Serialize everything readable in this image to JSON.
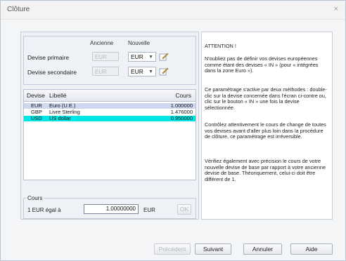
{
  "window": {
    "title": "Clôture",
    "close": "×"
  },
  "currency_config": {
    "header_old": "Ancienne",
    "header_new": "Nouvelle",
    "primary_label": "Devise primaire",
    "secondary_label": "Devise secondaire",
    "primary_old": "EUR",
    "primary_new": "EUR",
    "secondary_old": "EUR",
    "secondary_new": "EUR"
  },
  "table": {
    "headers": {
      "devise": "Devise",
      "libelle": "Libellé",
      "cours": "Cours"
    },
    "rows": [
      {
        "devise": "EUR",
        "libelle": "Euro (U.E.)",
        "cours": "1.000000"
      },
      {
        "devise": "GBP",
        "libelle": "Livre Sterling",
        "cours": "1.476000"
      },
      {
        "devise": "USD",
        "libelle": "US dollar",
        "cours": "0.950000"
      }
    ],
    "row_colors": [
      "#cfd8f0",
      "#ffffff",
      "#00e5e5"
    ]
  },
  "cours": {
    "group_label": "Cours",
    "prefix": "1 EUR égal à",
    "value": "1.00000000",
    "suffix": "EUR",
    "button": "OK"
  },
  "info": {
    "paragraphs": [
      "ATTENTION !",
      "N'oubliez pas de définir vos devises européennes comme étant des devises « IN » (pour « intégrées dans la zone Euro »).",
      "Ce paramétrage s'active par deux méthodes : double-clic sur la devise concernée dans l'écran ci-contre ou, clic sur le bouton « IN » une fois la devise sélectionnée.",
      "Contrôlez attentivement le cours de change de toutes vos devises avant d'aller plus loin dans la procédure de clôture, ce paramétrage est irréversible.",
      "Vérifiez également avec précision le cours de votre nouvelle devise de base par rapport à votre ancienne devise de base. Théoriquement, celui-ci doit être différent de 1."
    ]
  },
  "buttons": {
    "precedent": "Précédent",
    "suivant": "Suivant",
    "annuler": "Annuler",
    "aide": "Aide"
  }
}
